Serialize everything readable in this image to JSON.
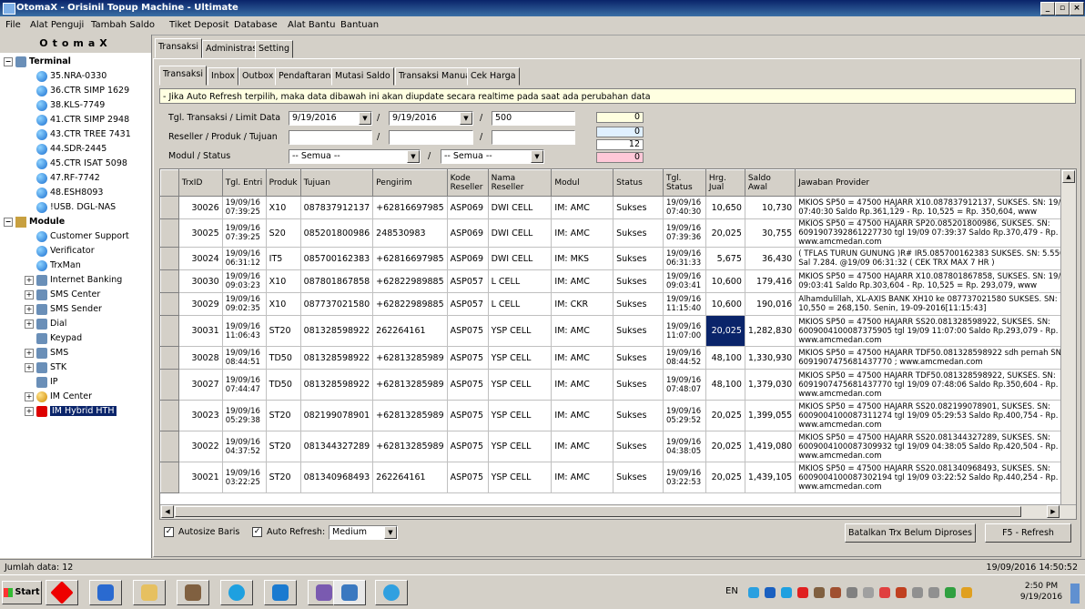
{
  "window": {
    "title": "OtomaX - Orisinil Topup Machine - Ultimate"
  },
  "menu": [
    "File",
    "Alat Penguji",
    "Tambah Saldo",
    "Tiket Deposit",
    "Database",
    "Alat Bantu",
    "Bantuan"
  ],
  "left_panel": {
    "title": "OtomaX",
    "terminal_label": "Terminal",
    "terminals": [
      "35.NRA-0330",
      "36.CTR SIMP 1629",
      "38.KLS-7749",
      "41.CTR SIMP 2948",
      "43.CTR TREE 7431",
      "44.SDR-2445",
      "45.CTR ISAT 5098",
      "47.RF-7742",
      "48.ESH8093",
      "!USB. DGL-NAS"
    ],
    "module_label": "Module",
    "modules": [
      "Customer Support",
      "Verificator",
      "TrxMan",
      "Internet Banking",
      "SMS Center",
      "SMS Sender",
      "Dial",
      "Keypad",
      "SMS",
      "STK",
      "IP",
      "IM Center",
      "IM Hybrid HTH"
    ]
  },
  "main_tabs": [
    "Transaksi",
    "Administrasi",
    "Setting"
  ],
  "sub_tabs": [
    "Transaksi",
    "Inbox",
    "Outbox",
    "Pendaftaran",
    "Mutasi Saldo",
    "Transaksi Manual",
    "Cek Harga"
  ],
  "info_text": "- Jika Auto Refresh terpilih, maka data dibawah ini akan diupdate secara realtime pada saat ada perubahan data",
  "filters": {
    "tgl_label": "Tgl. Transaksi / Limit Data",
    "date_from": "9/19/2016",
    "date_to": "9/19/2016",
    "limit": "500",
    "reseller_label": "Reseller / Produk / Tujuan",
    "modul_label": "Modul / Status",
    "modul_value": "-- Semua --",
    "status_value": "-- Semua --",
    "slash": "/"
  },
  "counters": [
    "0",
    "0",
    "12",
    "0"
  ],
  "counter_colors": [
    "#ffffe0",
    "#e0f0ff",
    "#ffffff",
    "#ffc8d8"
  ],
  "table": {
    "headers": [
      "TrxID",
      "Tgl. Entri",
      "Produk",
      "Tujuan",
      "Pengirim",
      "Kode Reseller",
      "Nama Reseller",
      "Modul",
      "Status",
      "Tgl. Status",
      "Hrg. Jual",
      "Saldo Awal",
      "Jawaban Provider"
    ],
    "rows": [
      [
        "30026",
        "19/09/16 07:39:25",
        "X10",
        "087837912137",
        "+62816697985",
        "ASP069",
        "DWI CELL",
        "IM: AMC",
        "Sukses",
        "19/09/16 07:40:30",
        "10,650",
        "10,730",
        "MKIOS SP50 = 47500 HAJARR X10.087837912137, SUKSES. SN: 19/09 07:40:30 Saldo Rp.361,129 - Rp. 10,525 = Rp. 350,604, www"
      ],
      [
        "30025",
        "19/09/16 07:39:25",
        "S20",
        "085201800986",
        "248530983",
        "ASP069",
        "DWI CELL",
        "IM: AMC",
        "Sukses",
        "19/09/16 07:39:36",
        "20,025",
        "30,755",
        "MKIOS SP50 = 47500 HAJARR SP20.085201800986, SUKSES. SN: 6091907392861227730 tgl 19/09 07:39:37 Saldo Rp.370,479 - Rp. www.amcmedan.com"
      ],
      [
        "30024",
        "19/09/16 06:31:12",
        "IT5",
        "085700162383",
        "+62816697985",
        "ASP069",
        "DWI CELL",
        "IM: MKS",
        "Sukses",
        "19/09/16 06:31:33",
        "5,675",
        "36,430",
        "( TFLAS TURUN GUNUNG )R# IR5.085700162383 SUKSES. SN: 5.550. Sal 7.284. @19/09 06:31:32 ( CEK TRX MAX 7 HR )"
      ],
      [
        "30030",
        "19/09/16 09:03:23",
        "X10",
        "087801867858",
        "+62822989885",
        "ASP057",
        "L CELL",
        "IM: AMC",
        "Sukses",
        "19/09/16 09:03:41",
        "10,600",
        "179,416",
        "MKIOS SP50 = 47500 HAJARR X10.087801867858, SUKSES. SN: 19/09 09:03:41 Saldo Rp.303,604 - Rp. 10,525 = Rp. 293,079, www"
      ],
      [
        "30029",
        "19/09/16 09:02:35",
        "X10",
        "087737021580",
        "+62822989885",
        "ASP057",
        "L CELL",
        "IM: CKR",
        "Sukses",
        "19/09/16 11:15:40",
        "10,600",
        "190,016",
        "Alhamdulillah, XL-AXIS BANK XH10 ke 087737021580 SUKSES. SN: 10,550 = 268,150. Senin, 19-09-2016[11:15:43]"
      ],
      [
        "30031",
        "19/09/16 11:06:43",
        "ST20",
        "081328598922",
        "262264161",
        "ASP075",
        "YSP CELL",
        "IM: AMC",
        "Sukses",
        "19/09/16 11:07:00",
        "20,025",
        "1,282,830",
        "MKIOS SP50 = 47500 HAJARR SS20.081328598922, SUKSES. SN: 6009004100087375905 tgl 19/09 11:07:00 Saldo Rp.293,079 - Rp. www.amcmedan.com"
      ],
      [
        "30028",
        "19/09/16 08:44:51",
        "TD50",
        "081328598922",
        "+62813285989",
        "ASP075",
        "YSP CELL",
        "IM: AMC",
        "Sukses",
        "19/09/16 08:44:52",
        "48,100",
        "1,330,930",
        "MKIOS SP50 = 47500 HAJARR TDF50.081328598922 sdh pernah SN: 6091907475681437770 ; www.amcmedan.com"
      ],
      [
        "30027",
        "19/09/16 07:44:47",
        "TD50",
        "081328598922",
        "+62813285989",
        "ASP075",
        "YSP CELL",
        "IM: AMC",
        "Sukses",
        "19/09/16 07:48:07",
        "48,100",
        "1,379,030",
        "MKIOS SP50 = 47500 HAJARR TDF50.081328598922, SUKSES. SN: 6091907475681437770 tgl 19/09 07:48:06 Saldo Rp.350,604 - Rp. www.amcmedan.com"
      ],
      [
        "30023",
        "19/09/16 05:29:38",
        "ST20",
        "082199078901",
        "+62813285989",
        "ASP075",
        "YSP CELL",
        "IM: AMC",
        "Sukses",
        "19/09/16 05:29:52",
        "20,025",
        "1,399,055",
        "MKIOS SP50 = 47500 HAJARR SS20.082199078901, SUKSES. SN: 6009004100087311274 tgl 19/09 05:29:53 Saldo Rp.400,754 - Rp. www.amcmedan.com"
      ],
      [
        "30022",
        "19/09/16 04:37:52",
        "ST20",
        "081344327289",
        "+62813285989",
        "ASP075",
        "YSP CELL",
        "IM: AMC",
        "Sukses",
        "19/09/16 04:38:05",
        "20,025",
        "1,419,080",
        "MKIOS SP50 = 47500 HAJARR SS20.081344327289, SUKSES. SN: 6009004100087309932 tgl 19/09 04:38:05 Saldo Rp.420,504 - Rp. www.amcmedan.com"
      ],
      [
        "30021",
        "19/09/16 03:22:25",
        "ST20",
        "081340968493",
        "262264161",
        "ASP075",
        "YSP CELL",
        "IM: AMC",
        "Sukses",
        "19/09/16 03:22:53",
        "20,025",
        "1,439,105",
        "MKIOS SP50 = 47500 HAJARR SS20.081340968493, SUKSES. SN: 6009004100087302194 tgl 19/09 03:22:52 Saldo Rp.440,254 - Rp. www.amcmedan.com"
      ]
    ]
  },
  "bottom": {
    "autosize_label": "Autosize Baris",
    "autorefresh_label": "Auto Refresh:",
    "refresh_rate": "Medium",
    "cancel_btn": "Batalkan Trx Belum Diproses",
    "refresh_btn": "F5 - Refresh"
  },
  "status": {
    "left": "Jumlah data: 12",
    "right": "19/09/2016 14:50:52"
  },
  "taskbar": {
    "start": "Start",
    "lang": "EN",
    "time": "2:50 PM",
    "date": "9/19/2016"
  },
  "icons": {
    "app": "app-icon",
    "terminal": "terminal-icon",
    "module": "module-icon",
    "start": "windows-logo-icon"
  }
}
